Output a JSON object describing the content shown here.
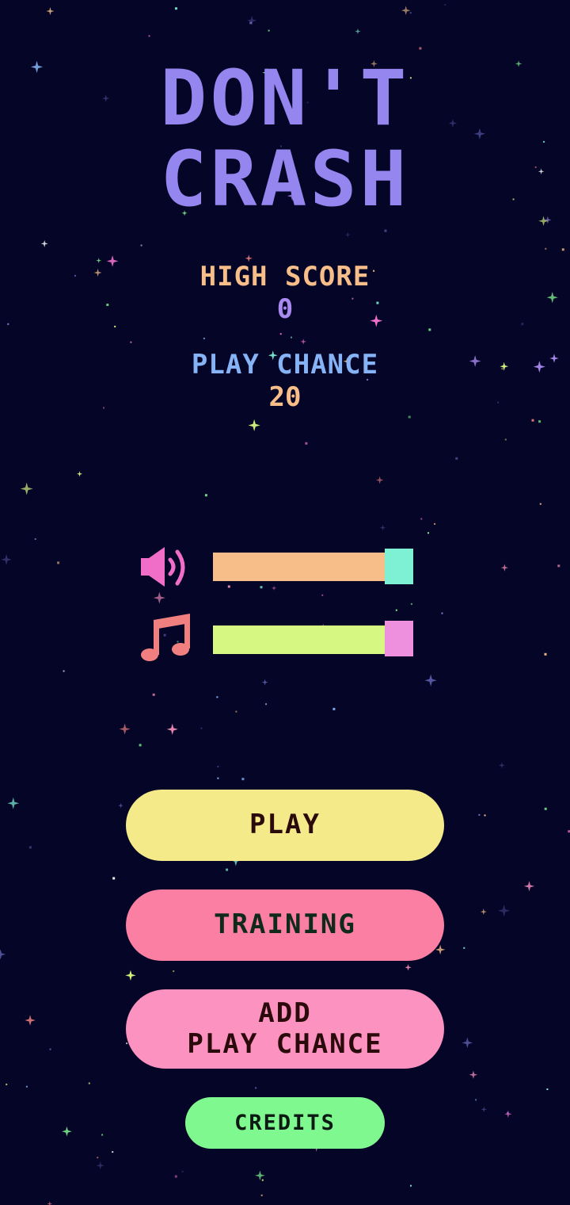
{
  "title": {
    "line1": "DON'T",
    "line2": "CRASH"
  },
  "high_score": {
    "label": "HIGH SCORE",
    "value": "0"
  },
  "play_chance": {
    "label": "PLAY CHANCE",
    "value": "20"
  },
  "settings": {
    "volume": {
      "icon": "speaker-icon",
      "level": 0.86
    },
    "music": {
      "icon": "music-note-icon",
      "level": 0.86
    }
  },
  "buttons": {
    "play": "PLAY",
    "training": "TRAINING",
    "add_line1": "ADD",
    "add_line2": "PLAY CHANCE",
    "credits": "CREDITS"
  },
  "colors": {
    "background": "#050527",
    "title": "#9585ee",
    "high_score_label": "#f7be8a",
    "high_score_value": "#a88af0",
    "play_chance_label": "#86b3f5",
    "play_chance_value": "#f7be8a",
    "volume_icon": "#f06ec8",
    "volume_fill": "#f7be8a",
    "volume_handle": "#7ef0d4",
    "music_icon": "#f08080",
    "music_fill": "#d6f781",
    "music_handle": "#ee90de",
    "play_button": "#f5ea8a",
    "training_button": "#fa7fa3",
    "add_button": "#fb92bf",
    "credits_button": "#80f890"
  }
}
